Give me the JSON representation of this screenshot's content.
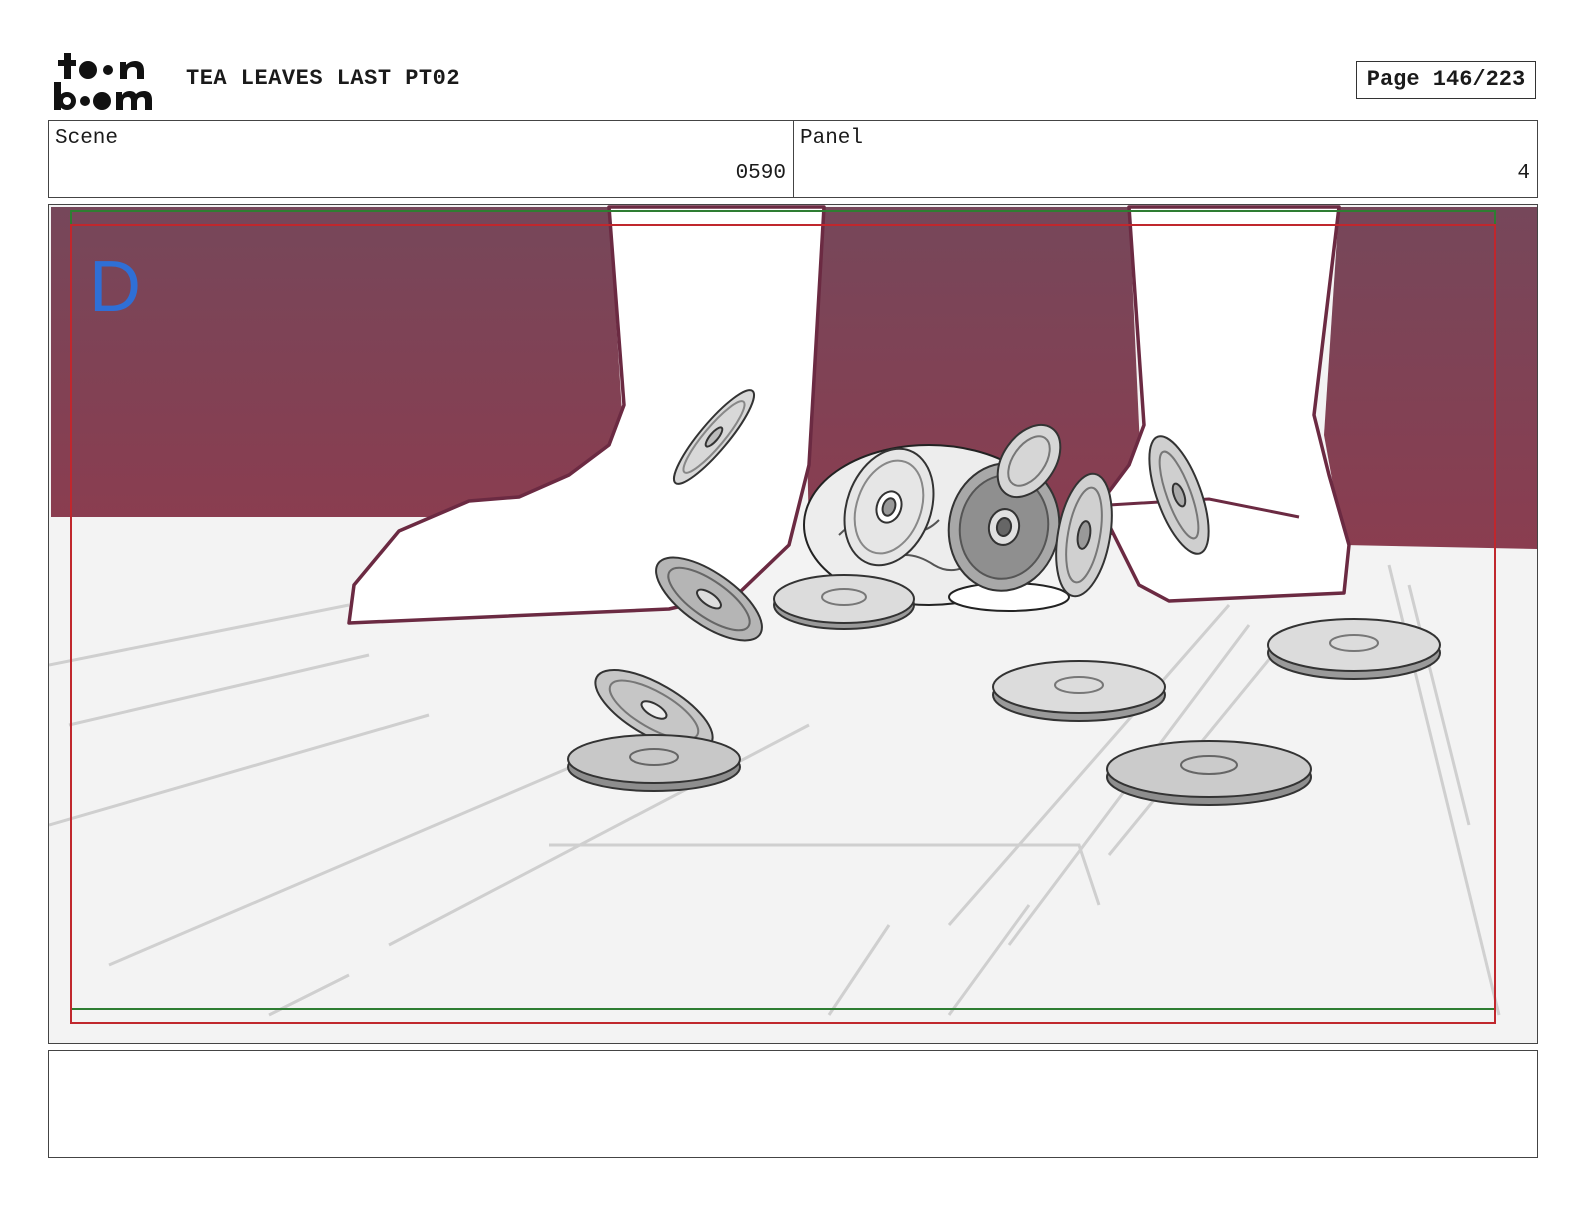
{
  "header": {
    "logo_alt": "toon boom",
    "project_title": "TEA LEAVES LAST PT02",
    "page_label": "Page 146/223"
  },
  "info": {
    "scene_label": "Scene",
    "scene_value": "0590",
    "panel_label": "Panel",
    "panel_value": "4"
  },
  "panel": {
    "marker_letter": "D",
    "colors": {
      "curtain": "#7e4452",
      "outline": "#6b2a42",
      "floor": "#f2f2f2",
      "safe_frame": "#c0272d",
      "title_safe": "#2e7d32",
      "marker": "#2f6fd6"
    }
  },
  "notes": {
    "text": ""
  }
}
